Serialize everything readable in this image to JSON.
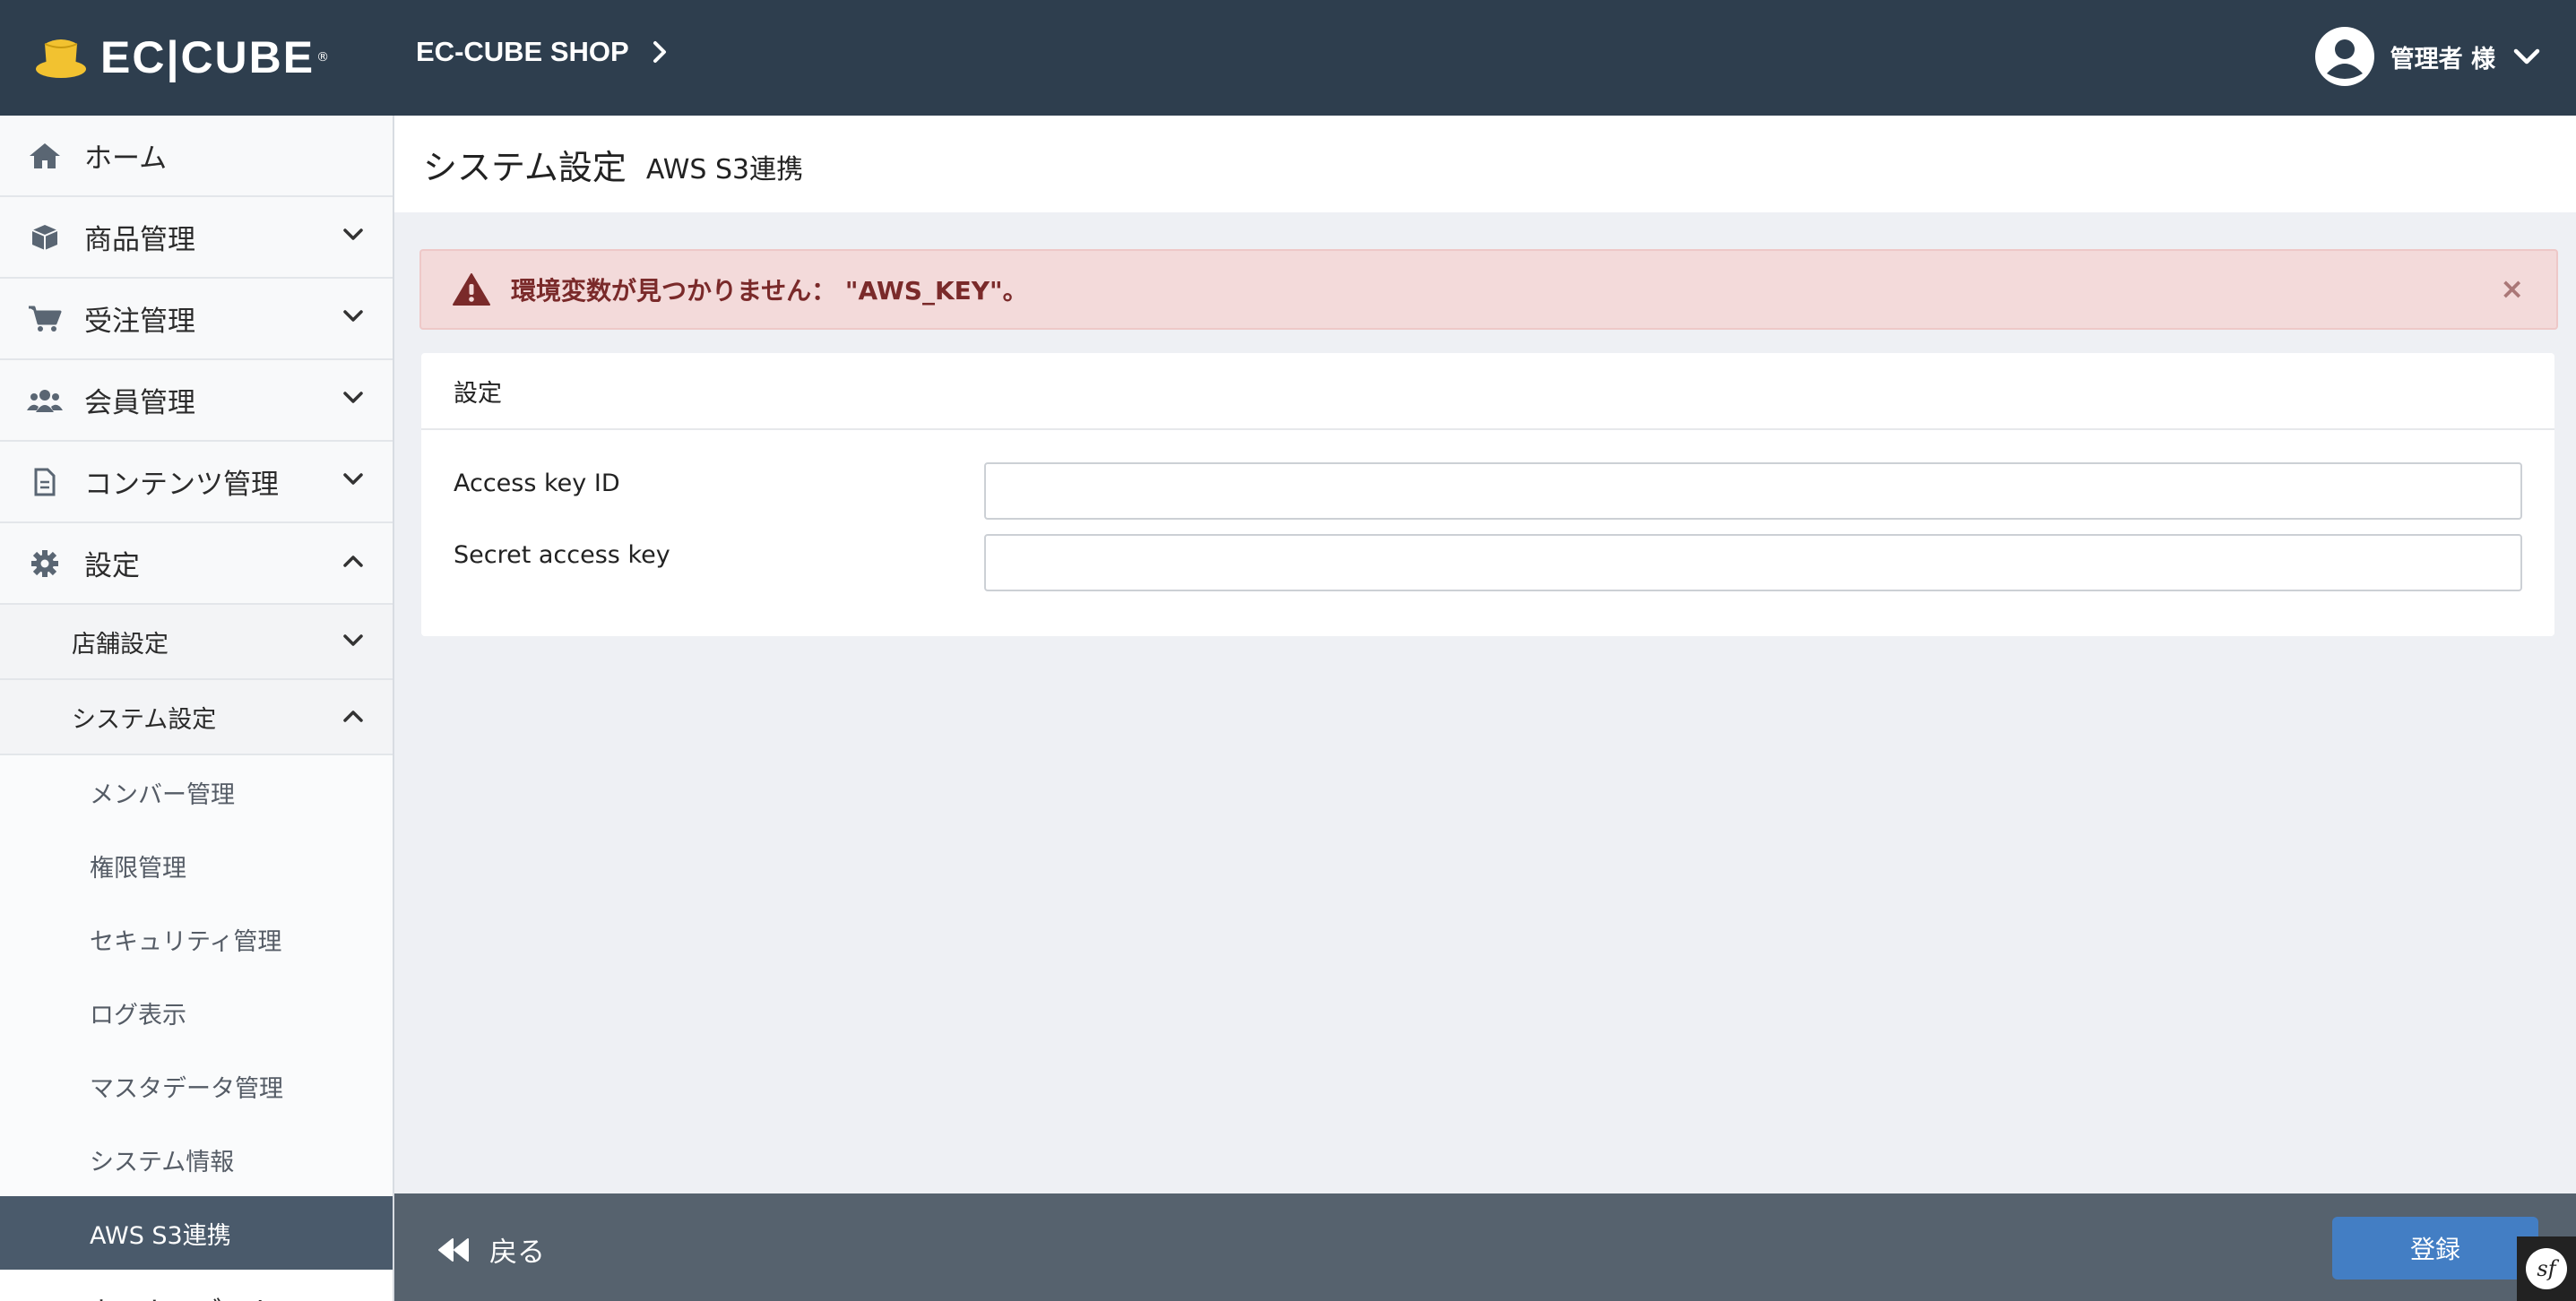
{
  "header": {
    "logo_text": "EC|CUBE",
    "logo_reg": "®",
    "shop_name": "EC-CUBE SHOP",
    "user_label": "管理者 様"
  },
  "sidebar": {
    "items": [
      {
        "label": "ホーム",
        "icon": "home-icon"
      },
      {
        "label": "商品管理",
        "icon": "box-icon"
      },
      {
        "label": "受注管理",
        "icon": "cart-icon"
      },
      {
        "label": "会員管理",
        "icon": "users-icon"
      },
      {
        "label": "コンテンツ管理",
        "icon": "document-icon"
      },
      {
        "label": "設定",
        "icon": "gear-icon"
      }
    ],
    "sub_items": [
      {
        "label": "店舗設定"
      },
      {
        "label": "システム設定"
      }
    ],
    "leaf_items": [
      {
        "label": "メンバー管理"
      },
      {
        "label": "権限管理"
      },
      {
        "label": "セキュリティ管理"
      },
      {
        "label": "ログ表示"
      },
      {
        "label": "マスタデータ管理"
      },
      {
        "label": "システム情報"
      },
      {
        "label": "AWS S3連携"
      }
    ],
    "cut_item": "オーナーズストア"
  },
  "page": {
    "title": "システム設定",
    "subtitle": "AWS S3連携"
  },
  "alert": {
    "message": "環境変数が見つかりません： \"AWS_KEY\"。",
    "close": "×"
  },
  "form": {
    "section_title": "設定",
    "fields": [
      {
        "label": "Access key ID",
        "value": ""
      },
      {
        "label": "Secret access key",
        "value": ""
      }
    ]
  },
  "footer": {
    "back_label": "戻る",
    "save_label": "登録"
  },
  "colors": {
    "header_bg": "#2e3e4e",
    "save_button": "#437ec4",
    "active_nav": "#4a5a6b",
    "alert_bg": "#f3dada"
  }
}
